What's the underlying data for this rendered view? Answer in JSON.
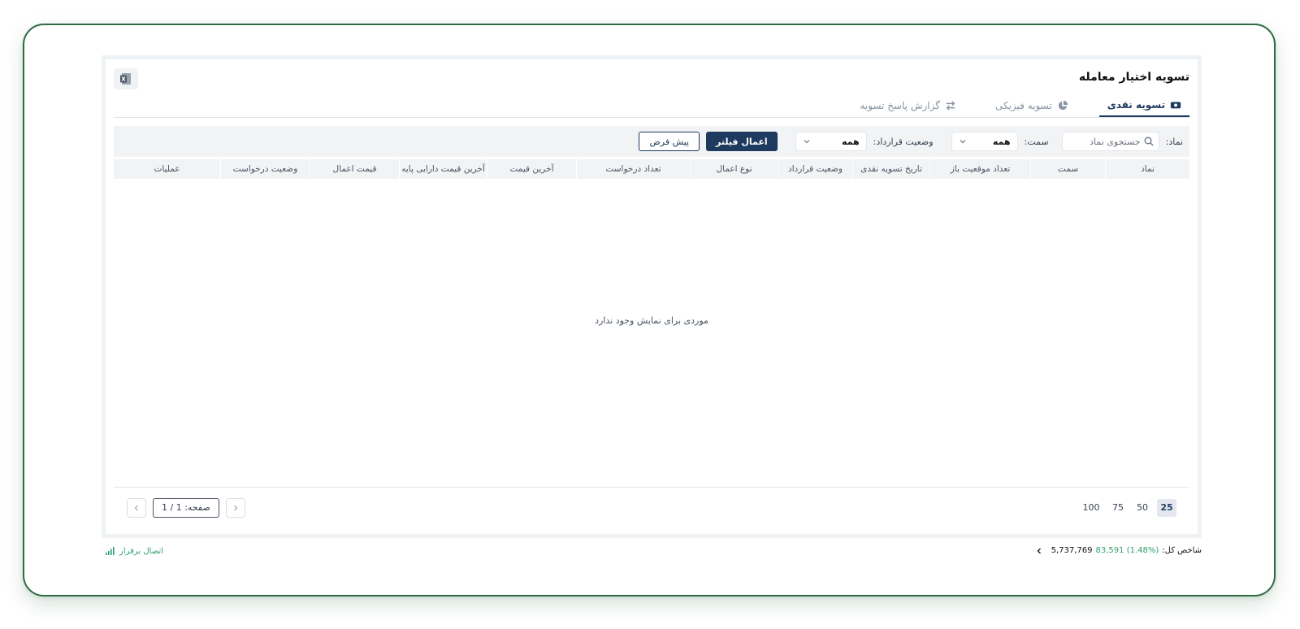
{
  "page": {
    "title": "تسویه اختیار معامله",
    "excel_icon": "excel-icon"
  },
  "tabs": [
    {
      "label": "تسویه نقدی",
      "icon": "cash-icon",
      "active": true
    },
    {
      "label": "تسویه فیزیکی",
      "icon": "pie-chart-icon",
      "active": false
    },
    {
      "label": "گزارش پاسخ تسویه",
      "icon": "swap-arrows-icon",
      "active": false
    }
  ],
  "filters": {
    "symbol_label": "نماد:",
    "symbol_placeholder": "جستجوی نماد",
    "side_label": "سمت:",
    "side_value": "همه",
    "contract_status_label": "وضعیت قرارداد:",
    "contract_status_value": "همه",
    "apply_label": "اعمال فیلتر",
    "default_label": "پیش فرض"
  },
  "table": {
    "columns": [
      "نماد",
      "سمت",
      "تعداد موقعیت باز",
      "تاریخ تسویه نقدی",
      "وضعیت قرارداد",
      "نوع اعمال",
      "تعداد درخواست",
      "آخرین قیمت",
      "آخرین قیمت دارایی پایه",
      "قیمت اعمال",
      "وضعیت درخواست",
      "عملیات"
    ],
    "empty_message": "موردی برای نمایش وجود ندارد"
  },
  "pagination": {
    "page_sizes": [
      "25",
      "50",
      "75",
      "100"
    ],
    "selected_size": "25",
    "page_info": "صفحه: 1 / 1"
  },
  "status": {
    "index_label": "شاخص کل:",
    "index_value": "5,737,769",
    "index_change": "83,591 (1.48%)",
    "connection": "اتصال برقرار"
  },
  "colors": {
    "primary": "#1e3a5f",
    "positive": "#2f9e6b",
    "frame": "#2e6b45"
  }
}
